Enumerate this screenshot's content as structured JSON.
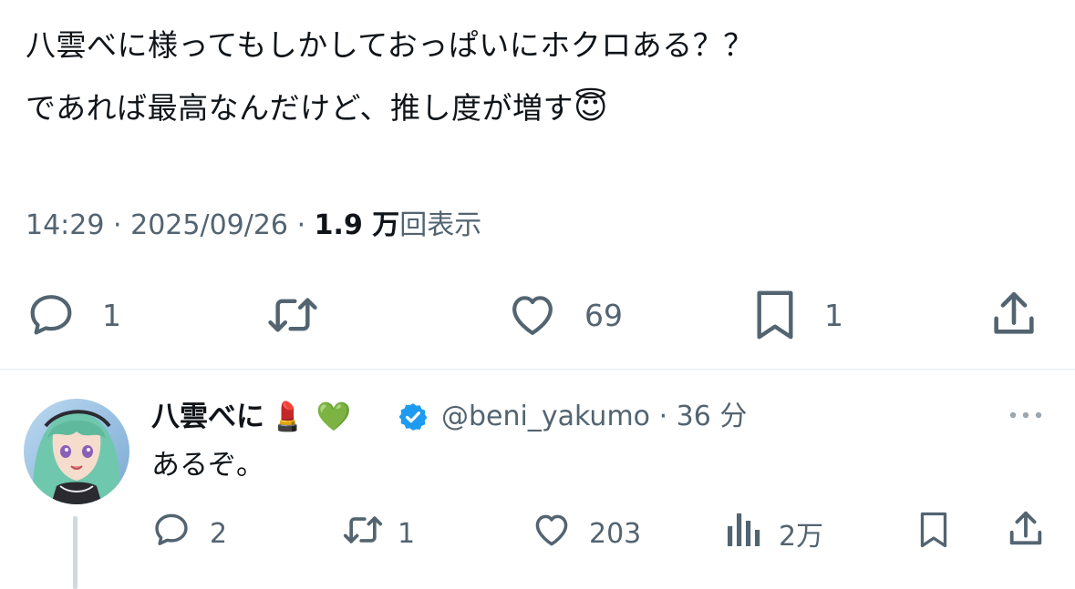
{
  "tweet": {
    "line1": "八雲べに様ってもしかしておっぱいにホクロある？？",
    "line2": "であれば最高なんだけど、推し度が増す",
    "emoji": "😇",
    "time": "14:29",
    "date": "2025/09/26",
    "views_count": "1.9 万",
    "views_label": "回表示",
    "sep": "·",
    "stats": {
      "replies": "1",
      "likes": "69",
      "bookmarks": "1"
    }
  },
  "reply": {
    "display_name": "八雲べに",
    "name_emoji1": "💄",
    "name_emoji2": "💚",
    "handle": "@beni_yakumo",
    "time": "36 分",
    "sep": "·",
    "text": "あるぞ。",
    "stats": {
      "replies": "2",
      "retweets": "1",
      "likes": "203",
      "views": "2万"
    }
  },
  "colors": {
    "text": "#0f1419",
    "secondary": "#536471",
    "verified": "#1d9bf0",
    "divider": "#e5e8eb",
    "thread_line": "#cfd9de"
  },
  "icons": [
    "reply-icon",
    "retweet-icon",
    "like-icon",
    "bookmark-icon",
    "share-icon",
    "views-icon",
    "verified-badge-icon",
    "more-icon",
    "avatar"
  ]
}
